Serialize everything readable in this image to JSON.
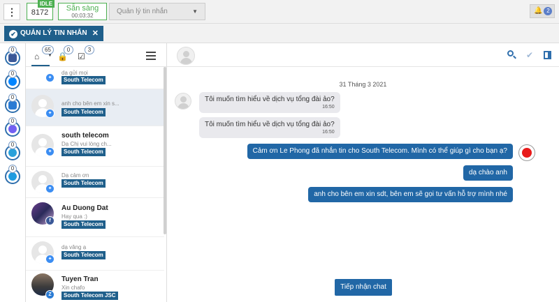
{
  "topbar": {
    "menu_icon": "vertical-ellipsis-icon",
    "menu_glyph": "⋮",
    "extension": "8172",
    "idle_label": "IDLE",
    "status_label": "Sẵn sàng",
    "status_timer": "00:03:32",
    "module_select": "Quản lý tin nhắn",
    "notification_count": "2"
  },
  "tab": {
    "label": "QUẢN LÝ TIN NHẮN",
    "close": "✕"
  },
  "channels": [
    {
      "icon": "facebook-icon",
      "count": "0",
      "color": "#3b5998"
    },
    {
      "icon": "messenger-icon",
      "count": "0",
      "color": "#0084ff"
    },
    {
      "icon": "zalo-icon",
      "count": "0",
      "color": "#2a7bd4"
    },
    {
      "icon": "viber-icon",
      "count": "0",
      "color": "#7360f2"
    },
    {
      "icon": "telegram-icon",
      "count": "0",
      "color": "#2aa1da"
    },
    {
      "icon": "chat-bubble-icon",
      "count": "0",
      "color": "#1e9be0"
    }
  ],
  "list_header": {
    "inbox_count": "65",
    "locked_count": "0",
    "done_count": "3"
  },
  "conversations": [
    {
      "name": "",
      "preview": "dạ gửi mọi",
      "tag": "South Telecom",
      "avatar": "default",
      "channel": "messenger"
    },
    {
      "name": "",
      "preview": "anh cho bên em xin s...",
      "tag": "South Telecom",
      "avatar": "default",
      "channel": "messenger",
      "selected": true
    },
    {
      "name": "south telecom",
      "preview": "Dạ Chị vui lòng ch...",
      "tag": "South Telecom",
      "avatar": "default",
      "channel": "messenger"
    },
    {
      "name": "",
      "preview": "Dạ cảm ơn",
      "tag": "South Telecom",
      "avatar": "default",
      "channel": "messenger"
    },
    {
      "name": "Au Duong Dat",
      "preview": "Hay qua :)",
      "tag": "South Telecom",
      "avatar": "photo",
      "channel": "facebook"
    },
    {
      "name": "",
      "preview": "dạ vâng ạ",
      "tag": "South Telecom",
      "avatar": "default",
      "channel": "messenger"
    },
    {
      "name": "Tuyen Tran",
      "preview": "Xin chafo",
      "tag": "South Telecom JSC",
      "avatar": "photo",
      "channel": "zalo"
    }
  ],
  "chat": {
    "date": "31 Tháng 3 2021",
    "incoming": [
      {
        "text": "Tôi muốn tìm hiểu về dịch vụ tổng đài ảo?",
        "time": "16:50"
      },
      {
        "text": "Tôi muốn tìm hiểu về dịch vụ tổng đài ảo?",
        "time": "16:50"
      }
    ],
    "outgoing": [
      {
        "text": "Cảm ơn Le Phong đã nhắn tin cho South Telecom. Mình có thể giúp gì cho bạn ạ?"
      },
      {
        "text": "dạ chào anh"
      },
      {
        "text": "anh cho bên em xin sdt, bên em sẽ gọi tư vấn hỗ trợ mình nhé"
      }
    ],
    "accept_button": "Tiếp nhận chat",
    "colors": {
      "outgoing_bubble": "#2167a6",
      "incoming_bubble": "#e9e9ed",
      "tag": "#1f5f8b",
      "status_green": "#4caf50",
      "record_red": "#e81a1a"
    }
  }
}
